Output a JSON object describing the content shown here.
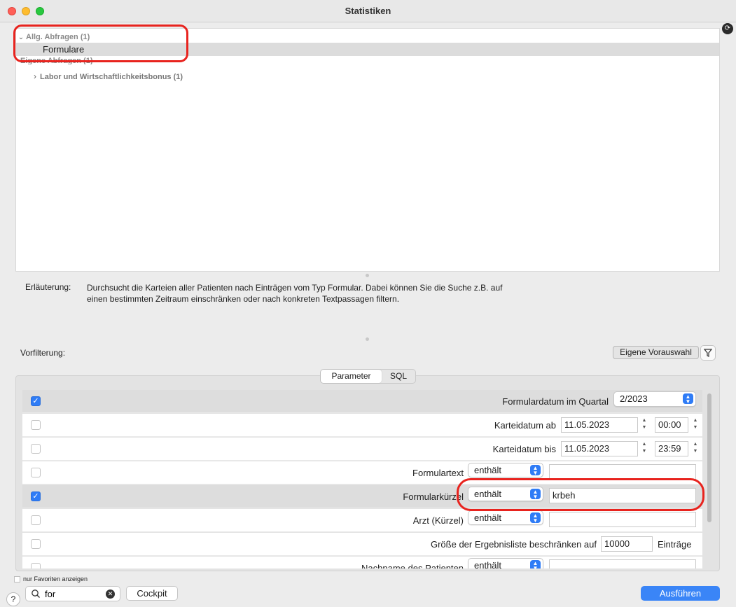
{
  "window": {
    "title": "Statistiken"
  },
  "tree": {
    "group1": "Allg. Abfragen (1)",
    "group1_item": "Formulare",
    "group2": "Eigene Abfragen (1)",
    "group3": "Labor und Wirtschaftlichkeitsbonus (1)"
  },
  "explanation": {
    "label": "Erläuterung:",
    "text": "Durchsucht die Karteien aller Patienten nach Einträgen vom Typ Formular. Dabei können Sie die Suche z.B. auf einen bestimmten Zeitraum einschränken oder nach konkreten Textpassagen filtern."
  },
  "prefilter": {
    "label": "Vorfilterung:",
    "own_selection": "Eigene Vorauswahl"
  },
  "tabs": {
    "parameter": "Parameter",
    "sql": "SQL"
  },
  "params": {
    "r1": {
      "label": "Formulardatum im Quartal",
      "value": "2/2023"
    },
    "r2": {
      "label": "Karteidatum ab",
      "date": "11.05.2023",
      "time": "00:00"
    },
    "r3": {
      "label": "Karteidatum bis",
      "date": "11.05.2023",
      "time": "23:59"
    },
    "r4": {
      "label": "Formulartext",
      "op": "enthält",
      "value": ""
    },
    "r5": {
      "label": "Formularkürzel",
      "op": "enthält",
      "value": "krbeh"
    },
    "r6": {
      "label": "Arzt (Kürzel)",
      "op": "enthält",
      "value": ""
    },
    "r7": {
      "label": "Größe der Ergebnisliste beschränken auf",
      "value": "10000",
      "suffix": "Einträge"
    },
    "r8": {
      "label": "Nachname des Patienten",
      "op": "enthält",
      "value": ""
    }
  },
  "footer": {
    "favorites_label": "nur Favoriten anzeigen",
    "help": "?",
    "search_value": "for",
    "cockpit": "Cockpit",
    "run": "Ausführen"
  },
  "colors": {
    "accent": "#2f7cf6",
    "annotation": "#e8231e"
  }
}
